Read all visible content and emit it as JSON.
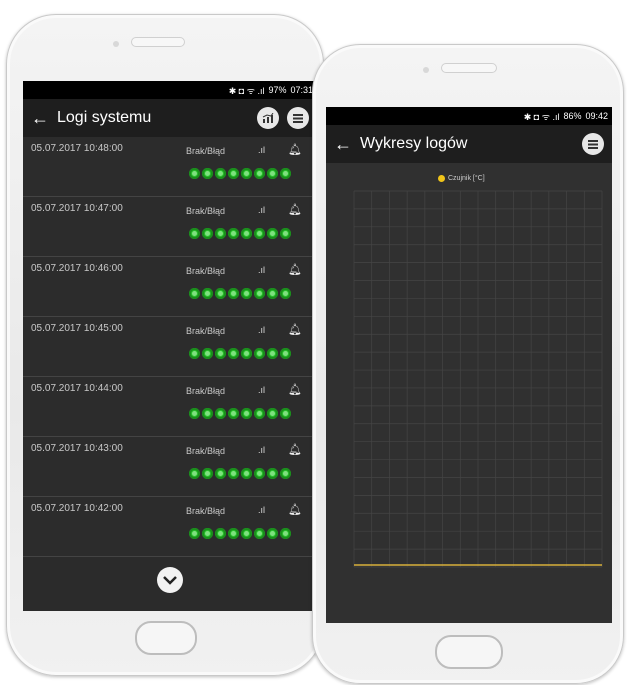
{
  "phone1": {
    "status": {
      "icons": "✱ ◘ ᯤ .ıl",
      "battery": "97%",
      "time": "07:31"
    },
    "toolbar": {
      "back": "←",
      "title": "Logi systemu"
    },
    "logs": [
      {
        "time": "05.07.2017 10:48:00",
        "status": "Brak/Błąd"
      },
      {
        "time": "05.07.2017 10:47:00",
        "status": "Brak/Błąd"
      },
      {
        "time": "05.07.2017 10:46:00",
        "status": "Brak/Błąd"
      },
      {
        "time": "05.07.2017 10:45:00",
        "status": "Brak/Błąd"
      },
      {
        "time": "05.07.2017 10:44:00",
        "status": "Brak/Błąd"
      },
      {
        "time": "05.07.2017 10:43:00",
        "status": "Brak/Błąd"
      },
      {
        "time": "05.07.2017 10:42:00",
        "status": "Brak/Błąd"
      }
    ],
    "scroll_icon": "chevron-down-icon"
  },
  "phone2": {
    "status": {
      "icons": "✱ ◘ ᯤ .ıl",
      "battery": "86%",
      "time": "09:42"
    },
    "toolbar": {
      "back": "←",
      "title": "Wykresy logów"
    },
    "chart_data": {
      "type": "line",
      "series": [
        {
          "name": "Czujnik [°C]",
          "color": "#f0c419"
        }
      ]
    }
  },
  "colors": {
    "accent_green": "#26c22a",
    "chart_line": "#d8b03a"
  }
}
